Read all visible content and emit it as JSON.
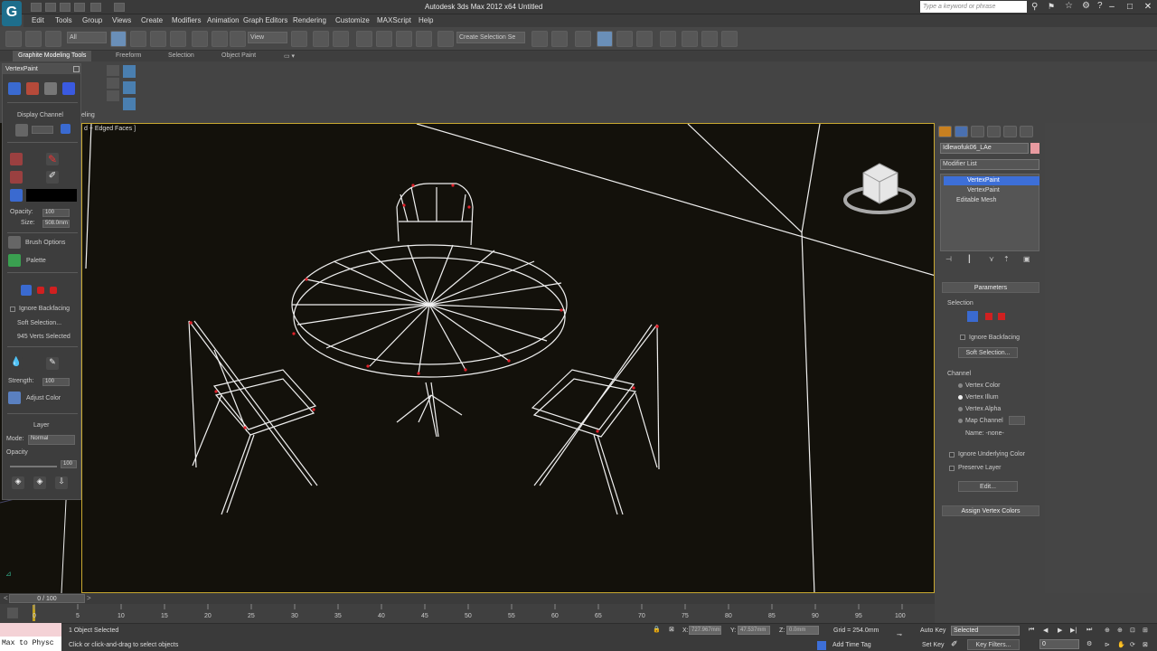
{
  "app": {
    "title": "Autodesk 3ds Max  2012 x64     Untitled",
    "logo": "G",
    "search_placeholder": "Type a keyword or phrase"
  },
  "menu": [
    "Edit",
    "Tools",
    "Group",
    "Views",
    "Create",
    "Modifiers",
    "Animation",
    "Graph Editors",
    "Rendering",
    "Customize",
    "MAXScript",
    "Help"
  ],
  "toolbar": {
    "selection_filter": "All",
    "ref_coord": "View",
    "named_selection": "Create Selection Se"
  },
  "ribbon": {
    "tabs": [
      "Graphite Modeling Tools",
      "Freeform",
      "Selection",
      "Object Paint"
    ],
    "panel_label": "eling"
  },
  "vertex_paint_panel": {
    "title": "VertexPaint",
    "display_channel": "Display Channel",
    "opacity_label": "Opacity:",
    "opacity_value": "100",
    "size_label": "Size:",
    "size_value": "508.0mm",
    "brush_options": "Brush Options",
    "palette": "Palette",
    "ignore_backfacing": "Ignore Backfacing",
    "soft_selection": "Soft Selection...",
    "verts_selected": "945 Verts Selected",
    "strength_label": "Strength:",
    "strength_value": "100",
    "adjust_color": "Adjust Color",
    "layer": "Layer",
    "mode_label": "Mode:",
    "mode_value": "Normal",
    "opacity2_label": "Opacity",
    "opacity2_value": "100"
  },
  "viewport": {
    "label": "d + Edged Faces ]"
  },
  "command_panel": {
    "object_name": "Idlewofuk06_LAe",
    "modifier_list": "Modifier List",
    "stack": [
      "VertexPaint",
      "VertexPaint",
      "Editable Mesh"
    ],
    "parameters": "Parameters",
    "selection": "Selection",
    "ignore_backfacing": "Ignore Backfacing",
    "soft_selection": "Soft Selection...",
    "channel": "Channel",
    "channels": [
      "Vertex Color",
      "Vertex Illum",
      "Vertex Alpha",
      "Map Channel"
    ],
    "selected_channel": "Vertex Illum",
    "name_label": "Name: -none-",
    "ignore_underlying": "Ignore Underlying Color",
    "preserve_layer": "Preserve Layer",
    "edit_button": "Edit...",
    "assign_vertex_colors": "Assign Vertex Colors"
  },
  "timeline": {
    "frame": "0 / 100",
    "ticks": [
      "0",
      "5",
      "10",
      "15",
      "20",
      "25",
      "30",
      "35",
      "40",
      "45",
      "50",
      "55",
      "60",
      "65",
      "70",
      "75",
      "80",
      "85",
      "90",
      "95",
      "100"
    ],
    "progress": 0
  },
  "status": {
    "maxscript_line1": "",
    "maxscript_line2": "Max to Physc",
    "selection_info": "1 Object Selected",
    "prompt": "Click or click-and-drag to select objects",
    "x": "727.967mm",
    "y": "47.537mm",
    "z": "0.0mm",
    "grid": "Grid = 254.0mm",
    "add_time_tag": "Add Time Tag",
    "auto_key": "Auto Key",
    "set_key": "Set Key",
    "key_mode": "Selected",
    "key_filters": "Key Filters...",
    "current_frame": "0"
  },
  "colors": {
    "viewport_bg": "#13110b",
    "wire": "#f0f0f0",
    "selected_verts": "#e0202a",
    "active_border": "#c8a830",
    "highlight": "#3d6fd8"
  }
}
